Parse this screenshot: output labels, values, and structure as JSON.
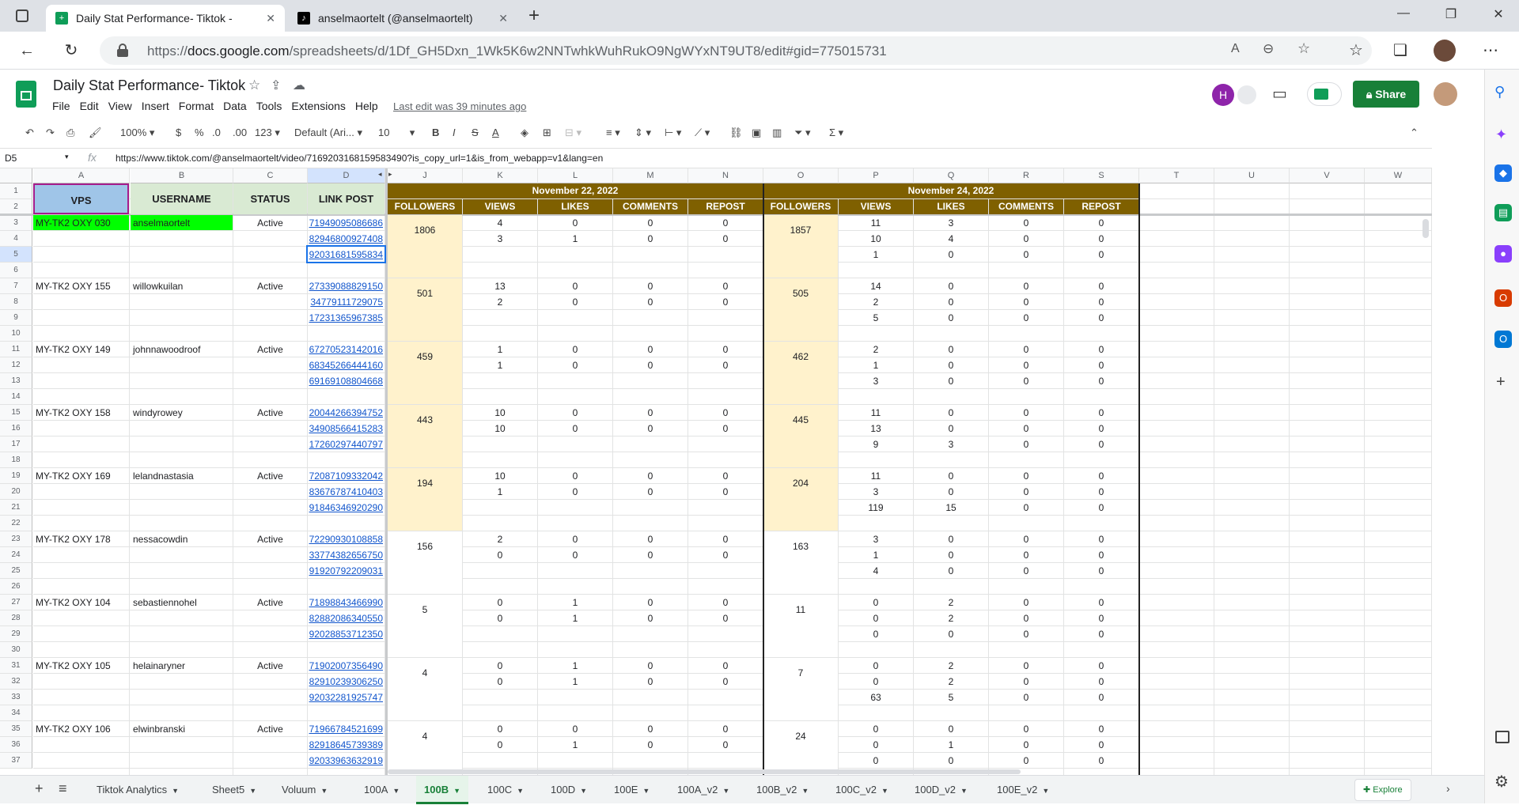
{
  "browser": {
    "tabs": [
      {
        "title": "Daily Stat Performance- Tiktok - ",
        "active": true
      },
      {
        "title": "anselmaortelt (@anselmaortelt) ",
        "active": false
      }
    ],
    "url_prefix": "https://",
    "url_domain": "docs.google.com",
    "url_path": "/spreadsheets/d/1Df_GH5Dxn_1Wk5K6w2NNTwhkWuhRukO9NgWYxNT9UT8/edit#gid=775015731"
  },
  "doc": {
    "title": "Daily Stat Performance- Tiktok",
    "menu": [
      "File",
      "Edit",
      "View",
      "Insert",
      "Format",
      "Data",
      "Tools",
      "Extensions",
      "Help"
    ],
    "last_edit": "Last edit was 39 minutes ago",
    "share_label": "Share",
    "avatar_letter": "H"
  },
  "toolbar": {
    "zoom": "100%",
    "currency": "$",
    "percent": "%",
    "dec_less": ".0",
    "dec_more": ".00",
    "more_formats": "123",
    "font": "Default (Ari...",
    "font_size": "10"
  },
  "formula_bar": {
    "cell_ref": "D5",
    "fx": "fx",
    "value": "https://www.tiktok.com/@anselmaortelt/video/7169203168159583490?is_copy_url=1&is_from_webapp=v1&lang=en"
  },
  "columns": [
    "A",
    "B",
    "C",
    "D",
    "J",
    "K",
    "L",
    "M",
    "N",
    "O",
    "P",
    "Q",
    "R",
    "S",
    "T",
    "U",
    "V",
    "W"
  ],
  "date_headers": [
    "November 22, 2022",
    "November 24, 2022"
  ],
  "headers": {
    "vps": "VPS",
    "username": "USERNAME",
    "status": "STATUS",
    "link": "LINK POST",
    "metrics": [
      "FOLLOWERS",
      "VIEWS",
      "LIKES",
      "COMMENTS",
      "REPOST"
    ]
  },
  "accounts": [
    {
      "vps": "MY-TK2 OXY 030",
      "username": "anselmaortelt",
      "status": "Active",
      "first_row": 3,
      "links": [
        "71949095086686",
        "82946800927408",
        "92031681595834"
      ],
      "f1": "1806",
      "d1": [
        [
          "4",
          "0",
          "0",
          "0"
        ],
        [
          "3",
          "1",
          "0",
          "0"
        ],
        [
          "",
          "",
          "",
          ""
        ]
      ],
      "f2": "1857",
      "d2": [
        [
          "11",
          "3",
          "0",
          "0"
        ],
        [
          "10",
          "4",
          "0",
          "0"
        ],
        [
          "1",
          "0",
          "0",
          "0"
        ]
      ]
    },
    {
      "vps": "MY-TK2 OXY 155",
      "username": "willowkuilan",
      "status": "Active",
      "first_row": 7,
      "links": [
        "27339088829150",
        "34779111729075",
        "17231365967385"
      ],
      "f1": "501",
      "d1": [
        [
          "13",
          "0",
          "0",
          "0"
        ],
        [
          "2",
          "0",
          "0",
          "0"
        ],
        [
          "",
          "",
          "",
          ""
        ]
      ],
      "f2": "505",
      "d2": [
        [
          "14",
          "0",
          "0",
          "0"
        ],
        [
          "2",
          "0",
          "0",
          "0"
        ],
        [
          "5",
          "0",
          "0",
          "0"
        ]
      ]
    },
    {
      "vps": "MY-TK2 OXY 149",
      "username": "johnnawoodroof",
      "status": "Active",
      "first_row": 11,
      "links": [
        "67270523142016",
        "68345266444160",
        "69169108804668"
      ],
      "f1": "459",
      "d1": [
        [
          "1",
          "0",
          "0",
          "0"
        ],
        [
          "1",
          "0",
          "0",
          "0"
        ],
        [
          "",
          "",
          "",
          ""
        ]
      ],
      "f2": "462",
      "d2": [
        [
          "2",
          "0",
          "0",
          "0"
        ],
        [
          "1",
          "0",
          "0",
          "0"
        ],
        [
          "3",
          "0",
          "0",
          "0"
        ]
      ]
    },
    {
      "vps": "MY-TK2 OXY 158",
      "username": "windyrowey",
      "status": "Active",
      "first_row": 15,
      "links": [
        "20044266394752",
        "34908566415283",
        "17260297440797"
      ],
      "f1": "443",
      "d1": [
        [
          "10",
          "0",
          "0",
          "0"
        ],
        [
          "10",
          "0",
          "0",
          "0"
        ],
        [
          "",
          "",
          "",
          ""
        ]
      ],
      "f2": "445",
      "d2": [
        [
          "11",
          "0",
          "0",
          "0"
        ],
        [
          "13",
          "0",
          "0",
          "0"
        ],
        [
          "9",
          "3",
          "0",
          "0"
        ]
      ]
    },
    {
      "vps": "MY-TK2 OXY 169",
      "username": "lelandnastasia",
      "status": "Active",
      "first_row": 19,
      "links": [
        "72087109332042",
        "83676787410403",
        "91846346920290"
      ],
      "f1": "194",
      "d1": [
        [
          "10",
          "0",
          "0",
          "0"
        ],
        [
          "1",
          "0",
          "0",
          "0"
        ],
        [
          "",
          "",
          "",
          ""
        ]
      ],
      "f2": "204",
      "d2": [
        [
          "11",
          "0",
          "0",
          "0"
        ],
        [
          "3",
          "0",
          "0",
          "0"
        ],
        [
          "119",
          "15",
          "0",
          "0"
        ]
      ]
    },
    {
      "vps": "MY-TK2 OXY 178",
      "username": "nessacowdin",
      "status": "Active",
      "first_row": 23,
      "links": [
        "72290930108858",
        "33774382656750",
        "91920792209031"
      ],
      "f1": "156",
      "d1": [
        [
          "2",
          "0",
          "0",
          "0"
        ],
        [
          "0",
          "0",
          "0",
          "0"
        ],
        [
          "",
          "",
          "",
          ""
        ]
      ],
      "f2": "163",
      "d2": [
        [
          "3",
          "0",
          "0",
          "0"
        ],
        [
          "1",
          "0",
          "0",
          "0"
        ],
        [
          "4",
          "0",
          "0",
          "0"
        ]
      ]
    },
    {
      "vps": "MY-TK2 OXY 104",
      "username": "sebastiennohel",
      "status": "Active",
      "first_row": 27,
      "links": [
        "71898843466990",
        "82882086340550",
        "92028853712350"
      ],
      "f1": "5",
      "d1": [
        [
          "0",
          "1",
          "0",
          "0"
        ],
        [
          "0",
          "1",
          "0",
          "0"
        ],
        [
          "",
          "",
          "",
          ""
        ]
      ],
      "f2": "11",
      "d2": [
        [
          "0",
          "2",
          "0",
          "0"
        ],
        [
          "0",
          "2",
          "0",
          "0"
        ],
        [
          "0",
          "0",
          "0",
          "0"
        ]
      ]
    },
    {
      "vps": "MY-TK2 OXY 105",
      "username": "helainaryner",
      "status": "Active",
      "first_row": 31,
      "links": [
        "71902007356490",
        "82910239306250",
        "92032281925747"
      ],
      "f1": "4",
      "d1": [
        [
          "0",
          "1",
          "0",
          "0"
        ],
        [
          "0",
          "1",
          "0",
          "0"
        ],
        [
          "",
          "",
          "",
          ""
        ]
      ],
      "f2": "7",
      "d2": [
        [
          "0",
          "2",
          "0",
          "0"
        ],
        [
          "0",
          "2",
          "0",
          "0"
        ],
        [
          "63",
          "5",
          "0",
          "0"
        ]
      ]
    },
    {
      "vps": "MY-TK2 OXY 106",
      "username": "elwinbranski",
      "status": "Active",
      "first_row": 35,
      "links": [
        "71966784521699",
        "82918645739389",
        "92033963632919"
      ],
      "f1": "4",
      "d1": [
        [
          "0",
          "0",
          "0",
          "0"
        ],
        [
          "0",
          "1",
          "0",
          "0"
        ],
        [
          "",
          "",
          "",
          ""
        ]
      ],
      "f2": "24",
      "d2": [
        [
          "0",
          "0",
          "0",
          "0"
        ],
        [
          "0",
          "1",
          "0",
          "0"
        ],
        [
          "0",
          "0",
          "0",
          "0"
        ]
      ]
    }
  ],
  "sheet_tabs": [
    "Tiktok Analytics",
    "Sheet5",
    "Voluum",
    "100A",
    "100B",
    "100C",
    "100D",
    "100E",
    "100A_v2",
    "100B_v2",
    "100C_v2",
    "100D_v2",
    "100E_v2"
  ],
  "active_sheet": "100B",
  "explore_label": "Explore",
  "colors": {
    "header_green": "#d9ead3",
    "vps_blue": "#9fc5e8",
    "highlight_green": "#00ff00",
    "date_brown": "#7f6000",
    "followers_yellow": "#fff2cc",
    "link_blue": "#1155cc",
    "share_green": "#188038"
  }
}
